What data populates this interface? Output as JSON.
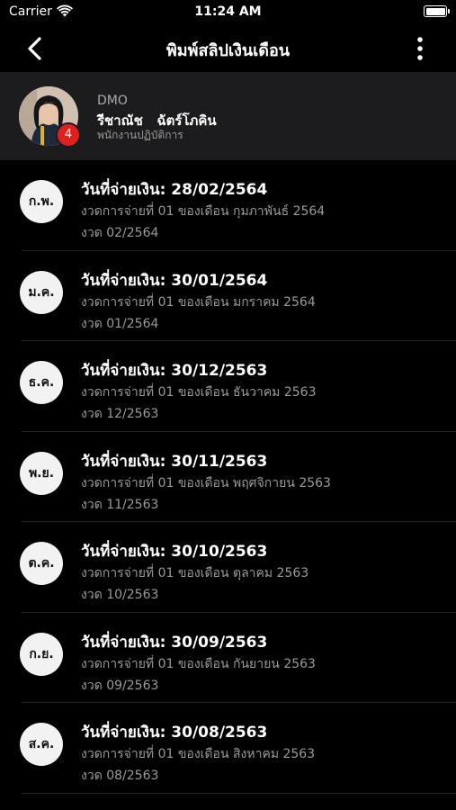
{
  "status_bar": {
    "carrier": "Carrier",
    "time": "11:24 AM"
  },
  "nav": {
    "title": "พิมพ์สลิปเงินเดือน"
  },
  "profile": {
    "code": "DMO",
    "name": "รีชาณัช   ฉัตร์โภคิน",
    "role": "พนักงานปฏิบัติการ",
    "badge_count": "4"
  },
  "payslips": [
    {
      "month_abbr": "ก.พ.",
      "date": "วันที่จ่ายเงิน: 28/02/2564",
      "desc": "งวดการจ่ายที่ 01 ของเดือน กุมภาพันธ์ 2564",
      "period": "งวด 02/2564"
    },
    {
      "month_abbr": "ม.ค.",
      "date": "วันที่จ่ายเงิน: 30/01/2564",
      "desc": "งวดการจ่ายที่ 01 ของเดือน มกราคม 2564",
      "period": "งวด 01/2564"
    },
    {
      "month_abbr": "ธ.ค.",
      "date": "วันที่จ่ายเงิน: 30/12/2563",
      "desc": "งวดการจ่ายที่ 01 ของเดือน ธันวาคม 2563",
      "period": "งวด 12/2563"
    },
    {
      "month_abbr": "พ.ย.",
      "date": "วันที่จ่ายเงิน: 30/11/2563",
      "desc": "งวดการจ่ายที่ 01 ของเดือน พฤศจิกายน 2563",
      "period": "งวด 11/2563"
    },
    {
      "month_abbr": "ต.ค.",
      "date": "วันที่จ่ายเงิน: 30/10/2563",
      "desc": "งวดการจ่ายที่ 01 ของเดือน ตุลาคม 2563",
      "period": "งวด 10/2563"
    },
    {
      "month_abbr": "ก.ย.",
      "date": "วันที่จ่ายเงิน: 30/09/2563",
      "desc": "งวดการจ่ายที่ 01 ของเดือน กันยายน 2563",
      "period": "งวด 09/2563"
    },
    {
      "month_abbr": "ส.ค.",
      "date": "วันที่จ่ายเงิน: 30/08/2563",
      "desc": "งวดการจ่ายที่ 01 ของเดือน สิงหาคม 2563",
      "period": "งวด 08/2563"
    }
  ],
  "colors": {
    "background": "#000000",
    "profile_bg": "#1c1c1e",
    "badge": "#e0201f",
    "secondary_text": "#9a9a9a"
  },
  "icons": {
    "back": "chevron-left-icon",
    "more": "more-vertical-icon",
    "wifi": "wifi-icon",
    "battery": "battery-icon"
  }
}
